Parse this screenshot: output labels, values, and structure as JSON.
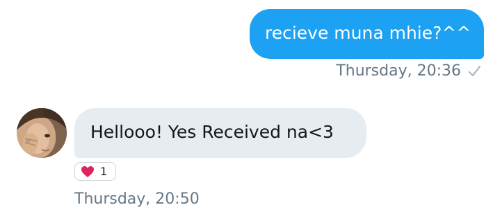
{
  "conversation": {
    "sent_message": {
      "text": "recieve muna mhie?^^",
      "timestamp": "Thursday, 20:36",
      "status_icon": "check-icon",
      "bubble_color": "#1da1f2"
    },
    "received_message": {
      "text": "Hellooo! Yes Received na<3",
      "timestamp": "Thursday, 20:50",
      "avatar_icon": "avatar",
      "bubble_color": "#e6ecf0",
      "reaction": {
        "emoji_icon": "heart-icon",
        "count": "1",
        "color": "#e0245e"
      }
    }
  }
}
